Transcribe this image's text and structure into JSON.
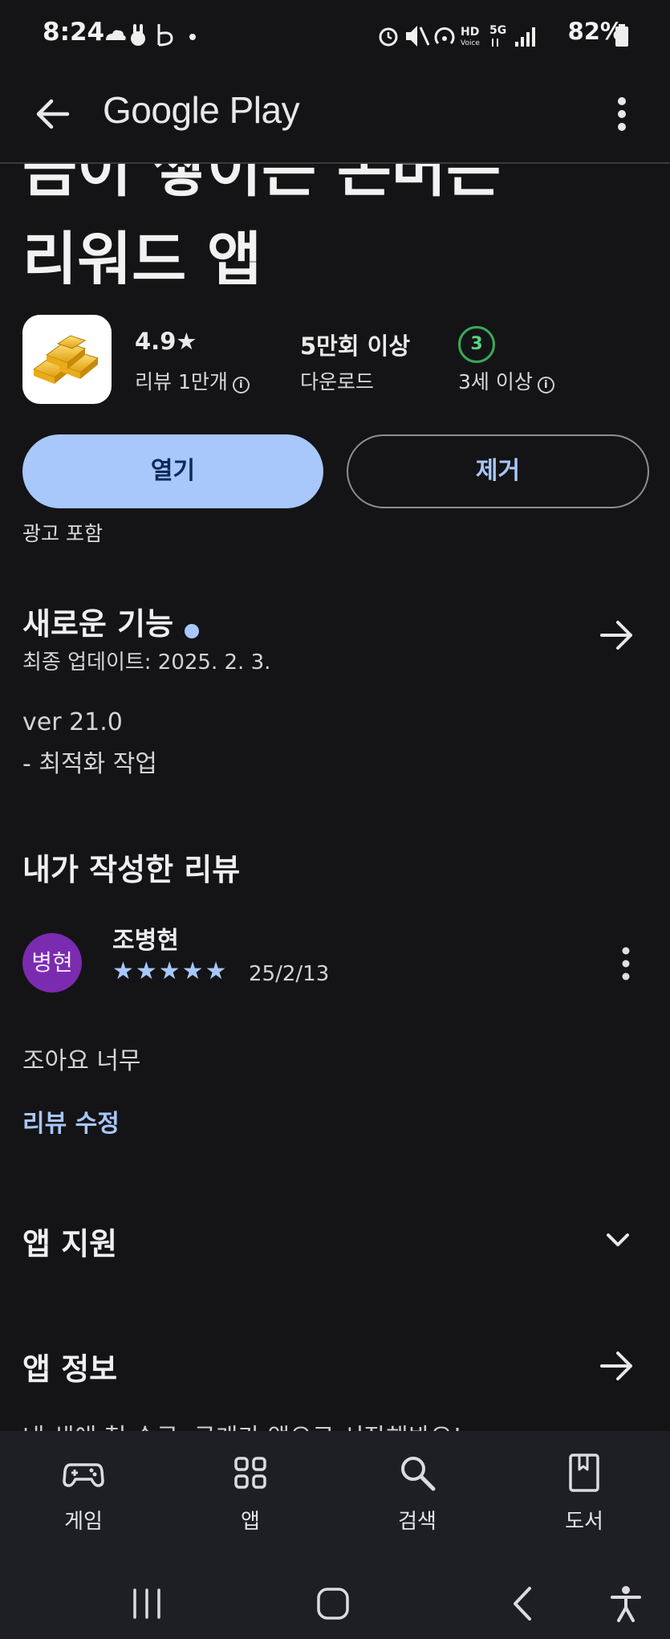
{
  "status_bar": {
    "time": "8:24",
    "battery": "82%",
    "left_icons": [
      "cloud-icon",
      "rabbit-icon",
      "b-app-icon",
      "dot-icon"
    ],
    "right_icons": [
      "alarm-icon",
      "mute-icon",
      "hotspot-icon",
      "hd-voice-icon",
      "5g-icon",
      "signal-icon",
      "battery-icon"
    ]
  },
  "app_bar": {
    "title": "Google Play"
  },
  "app": {
    "title_line1": "금이 쌓이는 돈버는",
    "title_line2": "리워드 앱",
    "rating": "4.9★",
    "rating_sub": "리뷰 1만개",
    "downloads": "5만회 이상",
    "downloads_sub": "다운로드",
    "age_rating": "3",
    "age_sub": "3세 이상",
    "open_label": "열기",
    "remove_label": "제거",
    "ad_note": "광고 포함"
  },
  "whats_new": {
    "title": "새로운 기능",
    "updated": "최종 업데이트: 2025. 2. 3.",
    "version": "ver 21.0",
    "change": "- 최적화 작업"
  },
  "my_review": {
    "title": "내가 작성한 리뷰",
    "avatar_text": "병현",
    "reviewer": "조병현",
    "stars": "★★★★★",
    "date": "25/2/13",
    "text": "조아요 너무",
    "edit_label": "리뷰 수정"
  },
  "sections": {
    "support": "앱 지원",
    "about": "앱 정보",
    "about_peek": "내 생애 첫 순금, 금개가 앱으로 시작해봐요!"
  },
  "bottom_nav": [
    {
      "label": "게임",
      "icon": "gamepad-icon"
    },
    {
      "label": "앱",
      "icon": "apps-grid-icon"
    },
    {
      "label": "검색",
      "icon": "search-icon"
    },
    {
      "label": "도서",
      "icon": "book-icon"
    }
  ],
  "colors": {
    "background": "#141416",
    "accent": "#a8c7fa",
    "avatar": "#7b2bb0",
    "age_green": "#3aa95a"
  }
}
